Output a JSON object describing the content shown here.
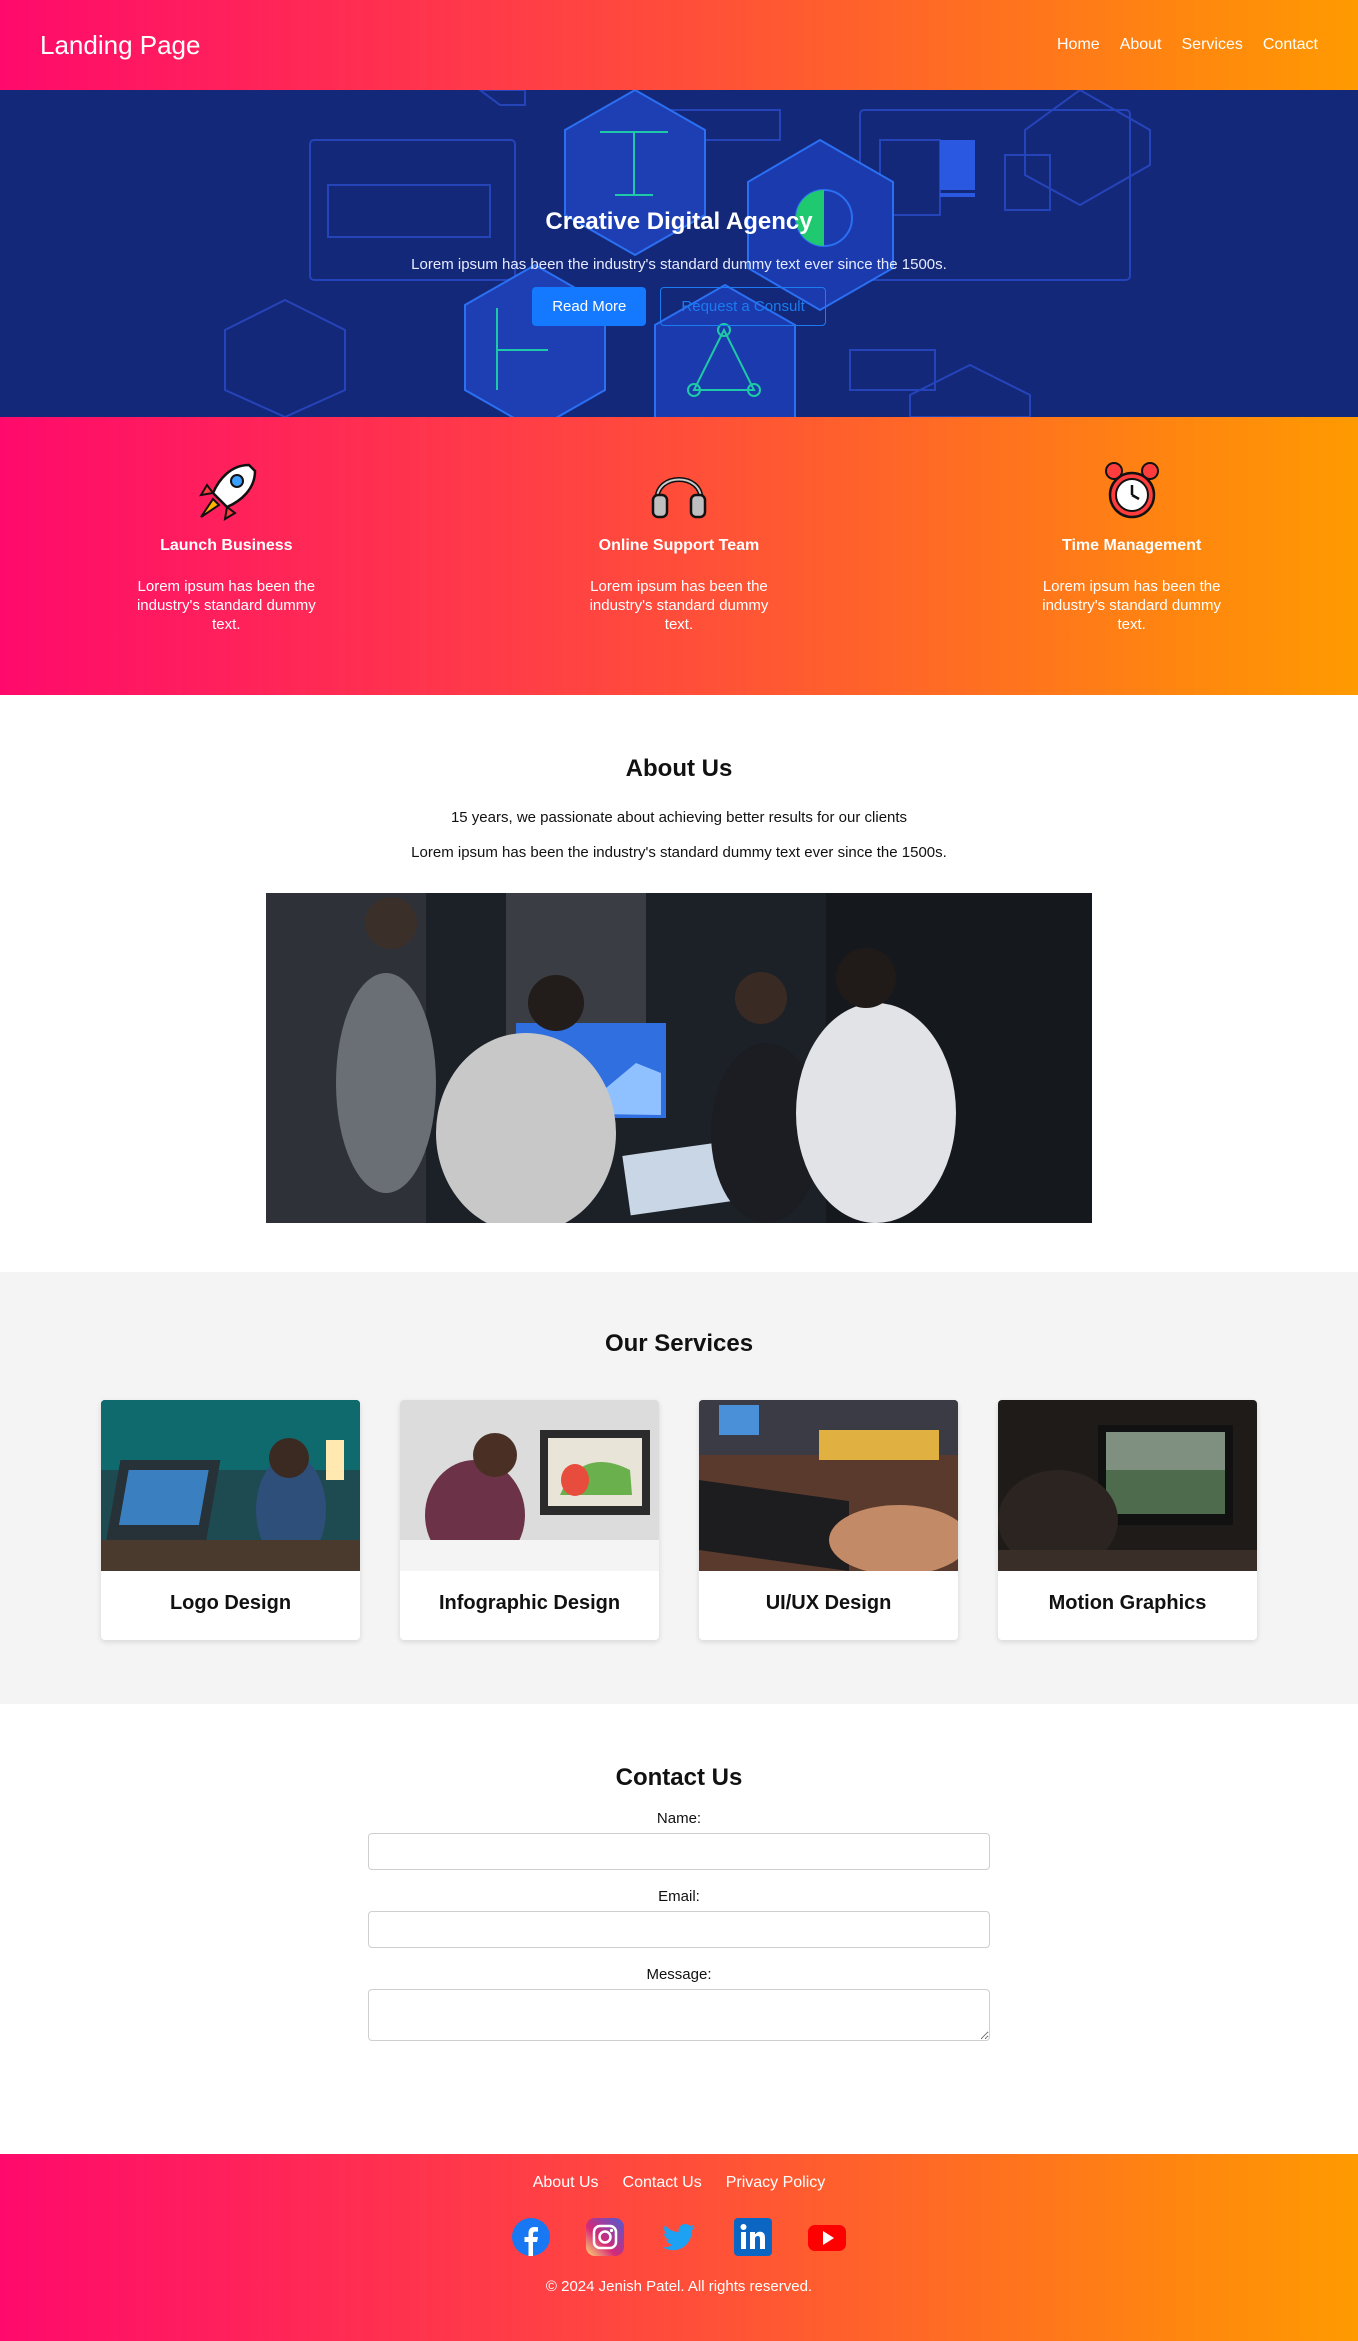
{
  "header": {
    "brand": "Landing Page",
    "nav": [
      "Home",
      "About",
      "Services",
      "Contact"
    ]
  },
  "hero": {
    "title": "Creative Digital Agency",
    "subtitle": "Lorem ipsum has been the industry's standard dummy text ever since the 1500s.",
    "primary_button": "Read More",
    "secondary_button": "Request a Consult"
  },
  "features": [
    {
      "icon": "rocket-icon",
      "title": "Launch Business",
      "text": "Lorem ipsum has been the industry's standard dummy text."
    },
    {
      "icon": "headphones-icon",
      "title": "Online Support Team",
      "text": "Lorem ipsum has been the industry's standard dummy text."
    },
    {
      "icon": "alarm-clock-icon",
      "title": "Time Management",
      "text": "Lorem ipsum has been the industry's standard dummy text."
    }
  ],
  "about": {
    "title": "About Us",
    "line1": "15 years, we passionate about achieving better results for our clients",
    "line2": "Lorem ipsum has been the industry's standard dummy text ever since the 1500s."
  },
  "services": {
    "title": "Our Services",
    "cards": [
      {
        "title": "Logo Design"
      },
      {
        "title": "Infographic Design"
      },
      {
        "title": "UI/UX Design"
      },
      {
        "title": "Motion Graphics"
      }
    ]
  },
  "contact": {
    "title": "Contact Us",
    "name_label": "Name:",
    "email_label": "Email:",
    "message_label": "Message:"
  },
  "footer": {
    "links": [
      "About Us",
      "Contact Us",
      "Privacy Policy"
    ],
    "social": [
      "facebook-icon",
      "instagram-icon",
      "twitter-icon",
      "linkedin-icon",
      "youtube-icon"
    ],
    "copyright": "© 2024 Jenish Patel. All rights reserved."
  },
  "colors": {
    "gradient_start": "#ff0a6c",
    "gradient_end": "#ff9a00",
    "hero_bg": "#14287a",
    "button_blue": "#1479ff"
  }
}
